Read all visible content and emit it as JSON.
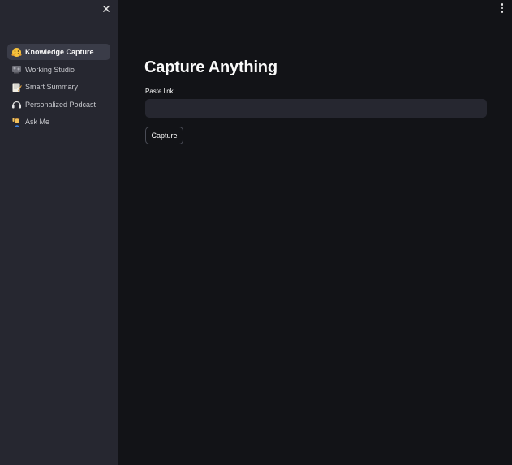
{
  "sidebar": {
    "close_label": "✕",
    "items": [
      {
        "label": "Knowledge Capture",
        "icon": "hugging-face-icon",
        "active": true
      },
      {
        "label": "Working Studio",
        "icon": "studio-icon",
        "active": false
      },
      {
        "label": "Smart Summary",
        "icon": "memo-icon",
        "active": false
      },
      {
        "label": "Personalized Podcast",
        "icon": "headphones-icon",
        "active": false
      },
      {
        "label": "Ask Me",
        "icon": "person-raising-hand-icon",
        "active": false
      }
    ]
  },
  "main": {
    "title": "Capture Anything",
    "input_label": "Paste link",
    "input_value": "",
    "input_placeholder": "",
    "button_label": "Capture"
  },
  "colors": {
    "sidebar_bg": "#262730",
    "main_bg": "#121317",
    "active_item_bg": "#3a3c48",
    "text": "#fafafa"
  }
}
